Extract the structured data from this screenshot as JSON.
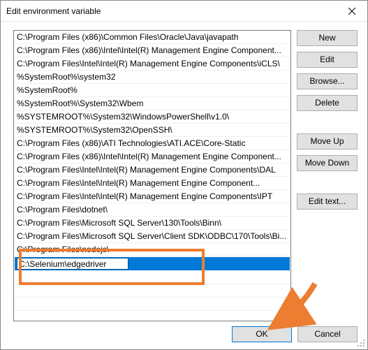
{
  "window": {
    "title": "Edit environment variable"
  },
  "items": [
    "C:\\Program Files (x86)\\Common Files\\Oracle\\Java\\javapath",
    "C:\\Program Files (x86)\\Intel\\Intel(R) Management Engine Component...",
    "C:\\Program Files\\Intel\\Intel(R) Management Engine Components\\iCLS\\",
    "%SystemRoot%\\system32",
    "%SystemRoot%",
    "%SystemRoot%\\System32\\Wbem",
    "%SYSTEMROOT%\\System32\\WindowsPowerShell\\v1.0\\",
    "%SYSTEMROOT%\\System32\\OpenSSH\\",
    "C:\\Program Files (x86)\\ATI Technologies\\ATI.ACE\\Core-Static",
    "C:\\Program Files (x86)\\Intel\\Intel(R) Management Engine Component...",
    "C:\\Program Files\\Intel\\Intel(R) Management Engine Components\\DAL",
    "C:\\Program Files\\Intel\\Intel(R) Management Engine Component...",
    "C:\\Program Files\\Intel\\Intel(R) Management Engine Components\\IPT",
    "C:\\Program Files\\dotnet\\",
    "C:\\Program Files\\Microsoft SQL Server\\130\\Tools\\Binn\\",
    "C:\\Program Files\\Microsoft SQL Server\\Client SDK\\ODBC\\170\\Tools\\Bi...",
    "C:\\Program Files\\nodejs\\"
  ],
  "selected_value": "C:\\Selenium\\edgedriver",
  "buttons": {
    "new": "New",
    "edit": "Edit",
    "browse": "Browse...",
    "delete": "Delete",
    "moveup": "Move Up",
    "movedown": "Move Down",
    "edittext": "Edit text...",
    "ok": "OK",
    "cancel": "Cancel"
  },
  "highlight_color": "#ed7d31"
}
